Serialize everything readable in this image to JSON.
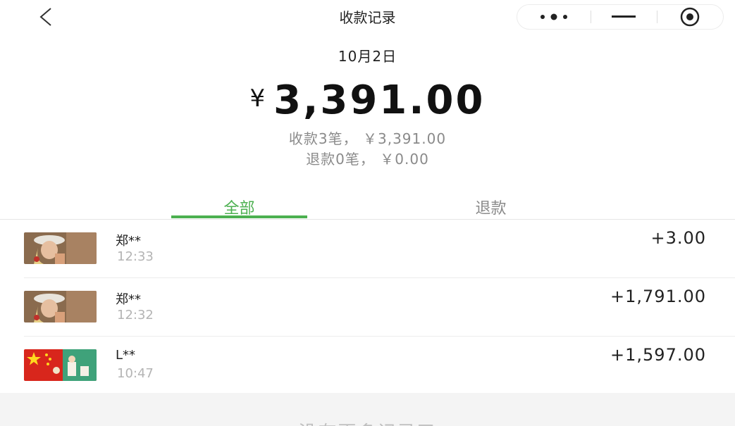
{
  "header": {
    "title": "收款记录",
    "back_icon": "chevron-left-icon",
    "capsule": {
      "more_icon": "more-dots-icon",
      "minimize_icon": "minimize-icon",
      "close_icon": "target-circle-icon"
    }
  },
  "summary": {
    "date": "10月2日",
    "currency_symbol": "¥",
    "total_amount": "3,391.00",
    "receipts_line": "收款3笔， ￥3,391.00",
    "refunds_line": "退款0笔， ￥0.00"
  },
  "tabs": [
    {
      "label": "全部",
      "active": true
    },
    {
      "label": "退款",
      "active": false
    }
  ],
  "transactions": [
    {
      "name": "郑**",
      "time": "12:33",
      "amount": "+3.00",
      "avatar": "portrait-avatar"
    },
    {
      "name": "郑**",
      "time": "12:32",
      "amount": "+1,791.00",
      "avatar": "portrait-avatar"
    },
    {
      "name": "L**",
      "time": "10:47",
      "amount": "+1,597.00",
      "avatar": "flag-avatar"
    }
  ],
  "footer": {
    "text": "没有更多记录了"
  },
  "colors": {
    "accent": "#4cb050",
    "muted": "#8a8a8a",
    "footer_bg": "#f4f4f4"
  }
}
